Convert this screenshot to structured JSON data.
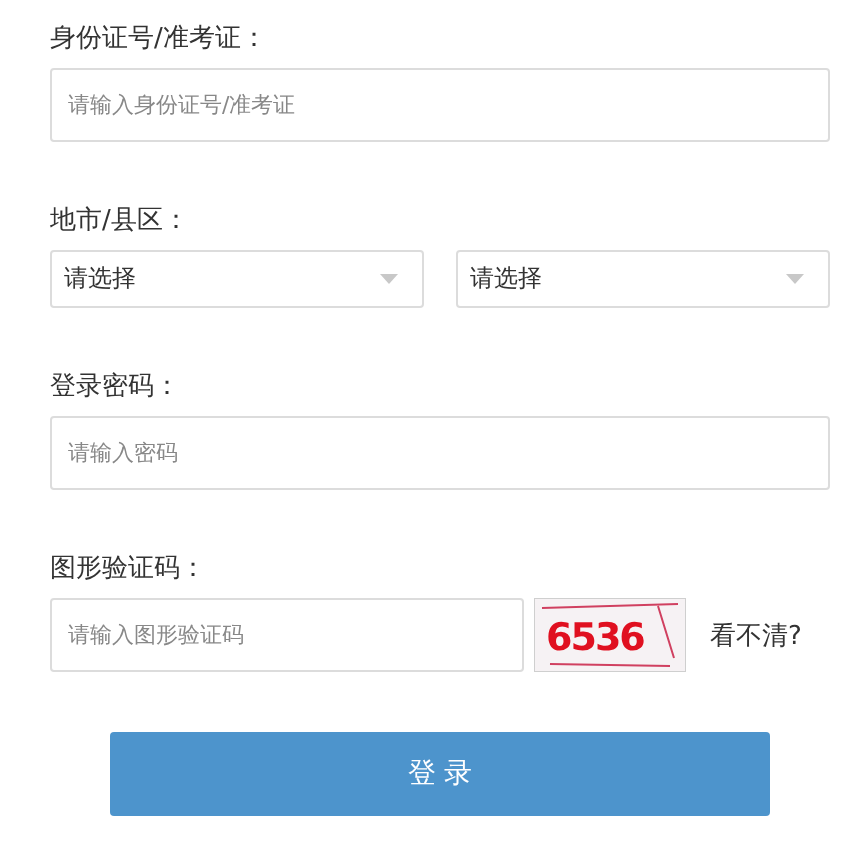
{
  "id_field": {
    "label": "身份证号/准考证：",
    "placeholder": "请输入身份证号/准考证"
  },
  "region": {
    "label": "地市/县区：",
    "selects": [
      {
        "value": "请选择"
      },
      {
        "value": "请选择"
      }
    ]
  },
  "password": {
    "label": "登录密码：",
    "placeholder": "请输入密码"
  },
  "captcha": {
    "label": "图形验证码：",
    "placeholder": "请输入图形验证码",
    "code": "6536",
    "refresh": "看不清?"
  },
  "submit": "登 录"
}
